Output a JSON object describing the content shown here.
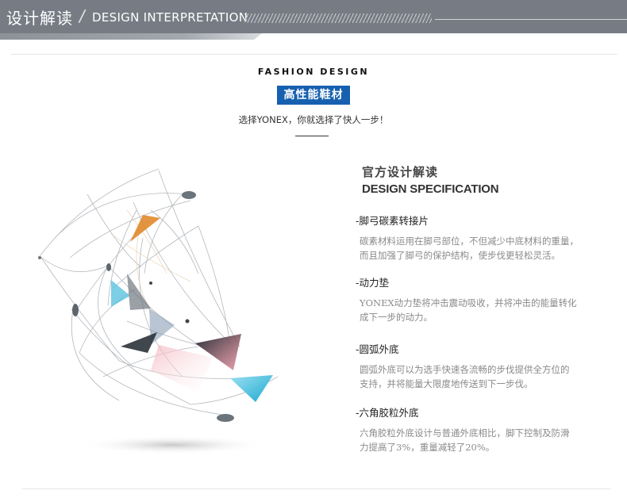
{
  "header": {
    "title": "设计解读",
    "subtitle": "DESIGN INTERPRETATION"
  },
  "intro": {
    "label": "FASHION DESIGN",
    "badge": "高性能鞋材",
    "tagline": "选择YONEX，你就选择了快人一步！"
  },
  "spec": {
    "title_cn": "官方设计解读",
    "title_en": "DESIGN SPECIFICATION"
  },
  "features": [
    {
      "title": "-脚弓碳素转接片",
      "desc": [
        "碳素材料运用在脚弓部位，不但减少中底材料的重量，",
        "而且加强了脚弓的保护结构，使步伐更轻松灵活。"
      ]
    },
    {
      "title": "-动力垫",
      "desc": [
        "YONEX动力垫将冲击震动吸收，并将冲击的能量转化",
        "成下一步的动力。"
      ]
    },
    {
      "title": "-圆弧外底",
      "desc": [
        "圆弧外底可以为选手快速各流畅的步伐提供全方位的",
        "支持，并将能量大限度地传送到下一步伐。"
      ]
    },
    {
      "title": "-六角胶粒外底",
      "desc": [
        "六角胶粒外底设计与普通外底相比，脚下控制及防滑",
        "力提高了3%，重量减轻了20%。"
      ]
    }
  ],
  "colors": {
    "header_bg": "#777c84",
    "badge_bg": "#1760b0",
    "accent_orange": "#e08a2c",
    "accent_cyan": "#2fb7d6",
    "accent_pink": "#e46a7f"
  }
}
